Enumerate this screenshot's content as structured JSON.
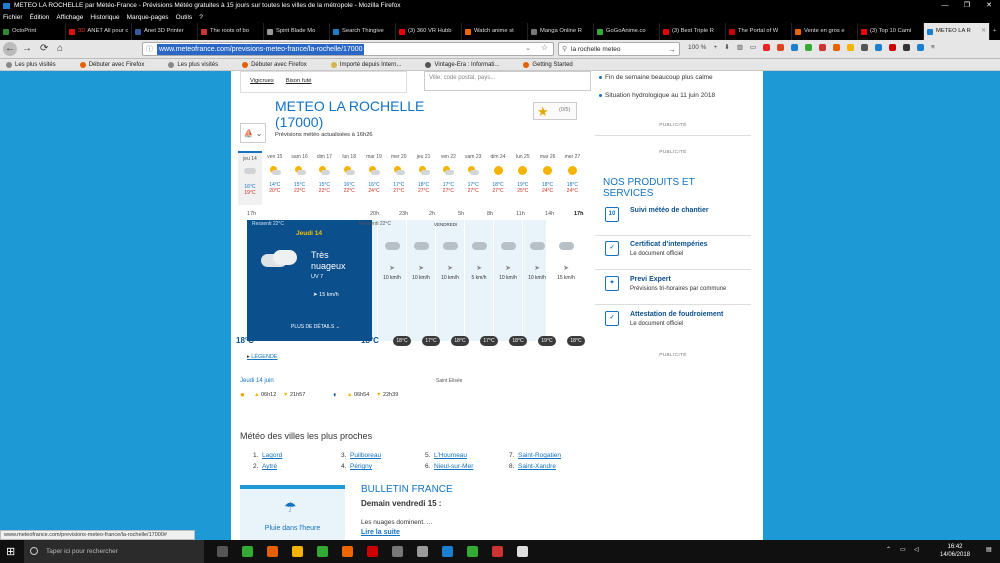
{
  "window": {
    "title": "METEO LA ROCHELLE par Météo-France - Prévisions Météo gratuites à 15 jours sur toutes les villes de la métropole - Mozilla Firefox",
    "controls": [
      "—",
      "❐",
      "✕"
    ]
  },
  "menu": [
    "Fichier",
    "Édition",
    "Affichage",
    "Historique",
    "Marque-pages",
    "Outils",
    "?"
  ],
  "tabs": [
    {
      "label": "OctoPrint",
      "color": "#2f8a2f"
    },
    {
      "label": "ANET All pour c",
      "color": "#d11",
      "prefix": "3D"
    },
    {
      "label": "Anet 3D Printer",
      "color": "#3b5998"
    },
    {
      "label": "The roots of bo",
      "color": "#c33"
    },
    {
      "label": "Spirit Blade Mo",
      "color": "#999"
    },
    {
      "label": "Search Thingive",
      "color": "#1a7fd0"
    },
    {
      "label": "(3) 360 VR Hubb",
      "color": "#e00"
    },
    {
      "label": "Watch anime st",
      "color": "#e60"
    },
    {
      "label": "Manga Online R",
      "color": "#777"
    },
    {
      "label": "GoGoAnime.co",
      "color": "#3a3"
    },
    {
      "label": "(3) Best Triple R",
      "color": "#e00"
    },
    {
      "label": "The Portal of W",
      "color": "#c00"
    },
    {
      "label": "Vente en gros e",
      "color": "#e60"
    },
    {
      "label": "(3) Top 10 Cami",
      "color": "#e00"
    },
    {
      "label": "METEO LA R",
      "color": "#1a7fd0",
      "active": true
    }
  ],
  "nav": {
    "url": "www.meteofrance.com/previsions-meteo-france/la-rochelle/17000",
    "search": "la rochelle meteo",
    "zoom": "100 %"
  },
  "bookmarks": [
    {
      "label": "Les plus visités",
      "color": "#888"
    },
    {
      "label": "Débuter avec Firefox",
      "color": "#e66000"
    },
    {
      "label": "Les plus visités",
      "color": "#888"
    },
    {
      "label": "Débuter avec Firefox",
      "color": "#e66000"
    },
    {
      "label": "Importé depuis Intern...",
      "color": "#d8b24a"
    },
    {
      "label": "Vintage-Era : Informati...",
      "color": "#555"
    },
    {
      "label": "Getting Started",
      "color": "#e66000"
    }
  ],
  "header": {
    "links": [
      "Vigicrues",
      "Bison futé"
    ],
    "city_placeholder": "Ville, code postal, pays..."
  },
  "city": {
    "name": "METEO LA ROCHELLE",
    "cp": "(17000)",
    "updated": "Prévisions météo actualisées à 16h26",
    "fav_count": "(0/5)"
  },
  "days": [
    {
      "d": "jeu 14",
      "icon": "cloud",
      "min": "16°C",
      "max": "19°C",
      "sel": true
    },
    {
      "d": "ven 15",
      "icon": "ps",
      "min": "14°C",
      "max": "20°C"
    },
    {
      "d": "sam 16",
      "icon": "ps",
      "min": "15°C",
      "max": "22°C"
    },
    {
      "d": "dim 17",
      "icon": "ps",
      "min": "15°C",
      "max": "22°C"
    },
    {
      "d": "lun 18",
      "icon": "ps",
      "min": "16°C",
      "max": "22°C"
    },
    {
      "d": "mar 19",
      "icon": "ps",
      "min": "16°C",
      "max": "24°C"
    },
    {
      "d": "mer 20",
      "icon": "ps",
      "min": "17°C",
      "max": "27°C"
    },
    {
      "d": "jeu 21",
      "icon": "ps",
      "min": "18°C",
      "max": "27°C"
    },
    {
      "d": "ven 22",
      "icon": "ps",
      "min": "17°C",
      "max": "27°C"
    },
    {
      "d": "sam 23",
      "icon": "ps",
      "min": "17°C",
      "max": "27°C"
    },
    {
      "d": "dim 24",
      "icon": "sun",
      "min": "18°C",
      "max": "27°C"
    },
    {
      "d": "lun 25",
      "icon": "sun",
      "min": "19°C",
      "max": "25°C"
    },
    {
      "d": "mar 26",
      "icon": "sun",
      "min": "18°C",
      "max": "24°C"
    },
    {
      "d": "mer 27",
      "icon": "sun",
      "min": "18°C",
      "max": "24°C"
    }
  ],
  "hours": [
    "17h",
    "20h",
    "23h",
    "2h",
    "5h",
    "8h",
    "11h",
    "14h",
    "17h"
  ],
  "detail": {
    "ressenti1": "Ressenti 22°C",
    "ressenti2": "Ressenti 22°C",
    "day": "Jeudi 14",
    "next_day": "VENDREDI",
    "cond1": "Très",
    "cond2": "nuageux",
    "uv": "UV 7",
    "wind": "15 km/h",
    "more": "PLUS DE DÉTAILS",
    "temp_now": "18°C",
    "temp_next": "18°C",
    "cols": [
      {
        "w": "10 km/h",
        "t": "18°C"
      },
      {
        "w": "10 km/h",
        "t": "17°C"
      },
      {
        "w": "10 km/h",
        "t": "18°C"
      },
      {
        "w": "5 km/h",
        "t": "17°C"
      },
      {
        "w": "10 km/h",
        "t": "18°C"
      },
      {
        "w": "10 km/h",
        "t": "19°C"
      },
      {
        "w": "15 km/h",
        "t": "18°C"
      }
    ]
  },
  "legende": "LÉGENDE",
  "ephem": {
    "date": "Jeudi 14 juin",
    "saint": "Saint Elisée",
    "sunrise": "06h12",
    "sunset": "21h57",
    "moonrise": "06h54",
    "moonset": "22h39"
  },
  "villes": {
    "title": "Météo des villes les plus proches",
    "list": [
      {
        "n": "1.",
        "v": "Lagord"
      },
      {
        "n": "2.",
        "v": "Aytré"
      },
      {
        "n": "3.",
        "v": "Puilboreau"
      },
      {
        "n": "4.",
        "v": "Périgny"
      },
      {
        "n": "5.",
        "v": "L'Houmeau"
      },
      {
        "n": "6.",
        "v": "Nieul-sur-Mer"
      },
      {
        "n": "7.",
        "v": "Saint-Rogatien"
      },
      {
        "n": "8.",
        "v": "Saint-Xandre"
      }
    ]
  },
  "pluie": "Pluie dans l'heure",
  "bulletin": {
    "title": "BULLETIN FRANCE",
    "sub": "Demain vendredi 15 :",
    "text": "Les nuages dominent. ...",
    "link": "Lire la suite"
  },
  "sidebar": {
    "news": [
      "Fin de semaine beaucoup plus calme",
      "Situation hydrologique au 11 juin 2018"
    ],
    "pub": "PUBLICITÉ",
    "products_title": "NOS PRODUITS ET SERVICES",
    "products": [
      {
        "t": "Suivi météo de chantier",
        "s": "",
        "icon": "10"
      },
      {
        "t": "Certificat d'intempéries",
        "s": "Le document officiel",
        "icon": "✓"
      },
      {
        "t": "Previ Expert",
        "s": "Prévisions tri-horaires par commune",
        "icon": "✦"
      },
      {
        "t": "Attestation de foudroiement",
        "s": "Le document officiel",
        "icon": "✓"
      }
    ]
  },
  "status": "www.meteofrance.com/previsions-meteo-france/la-rochelle/17000#",
  "taskbar": {
    "search": "Taper ici pour rechercher",
    "time": "16:42",
    "date": "14/06/2018",
    "apps": [
      "#555",
      "#3a3",
      "#e66000",
      "#f5b400",
      "#3a3",
      "#e60",
      "#c00",
      "#777",
      "#999",
      "#1a7fd0",
      "#3a3",
      "#c33",
      "#ddd"
    ]
  }
}
